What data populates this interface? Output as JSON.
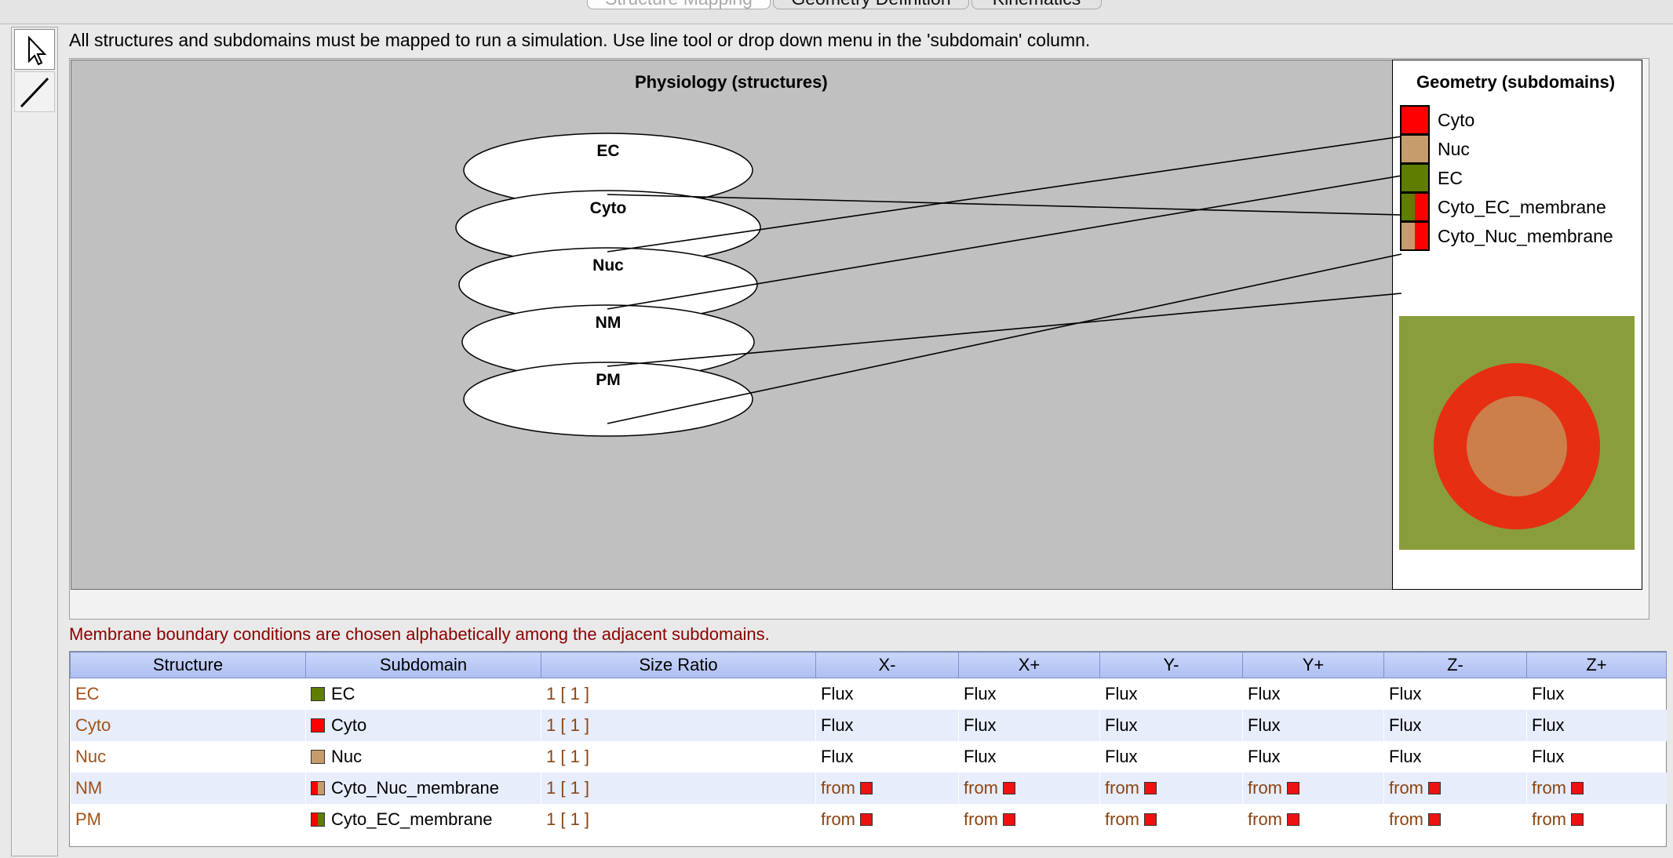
{
  "tabs": [
    {
      "label": "Structure Mapping",
      "selected": true
    },
    {
      "label": "Geometry Definition",
      "selected": false
    },
    {
      "label": "Kinematics",
      "selected": false
    }
  ],
  "tools": [
    {
      "icon": "select-arrow-icon"
    },
    {
      "icon": "line-tool-icon"
    }
  ],
  "hint": "All structures and subdomains must be mapped to run a simulation. Use line tool or drop down menu in the 'subdomain' column.",
  "physiology": {
    "title": "Physiology (structures)",
    "structures": [
      "EC",
      "Cyto",
      "Nuc",
      "NM",
      "PM"
    ]
  },
  "geometry": {
    "title": "Geometry (subdomains)",
    "subdomains": [
      {
        "label": "Cyto",
        "colors": [
          "#ff0000"
        ]
      },
      {
        "label": "Nuc",
        "colors": [
          "#c69c6d"
        ]
      },
      {
        "label": "EC",
        "colors": [
          "#5f7d00"
        ]
      },
      {
        "label": "Cyto_EC_membrane",
        "colors": [
          "#5f7d00",
          "#ff0000"
        ]
      },
      {
        "label": "Cyto_Nuc_membrane",
        "colors": [
          "#c69c6d",
          "#ff0000"
        ]
      }
    ]
  },
  "mappings": [
    {
      "structure": "EC",
      "subdomain": "EC"
    },
    {
      "structure": "Cyto",
      "subdomain": "Cyto"
    },
    {
      "structure": "Nuc",
      "subdomain": "Nuc"
    },
    {
      "structure": "NM",
      "subdomain": "Cyto_Nuc_membrane"
    },
    {
      "structure": "PM",
      "subdomain": "Cyto_EC_membrane"
    }
  ],
  "membrane_note": "Membrane boundary conditions are chosen alphabetically among the adjacent subdomains.",
  "table": {
    "headers": [
      "Structure",
      "Subdomain",
      "Size Ratio",
      "X-",
      "X+",
      "Y-",
      "Y+",
      "Z-",
      "Z+"
    ],
    "rows": [
      {
        "structure": "EC",
        "subdomain": "EC",
        "colors": [
          "#5f7d00"
        ],
        "ratio": "1 [ 1 ]",
        "bc": [
          "Flux",
          "Flux",
          "Flux",
          "Flux",
          "Flux",
          "Flux"
        ],
        "from": false
      },
      {
        "structure": "Cyto",
        "subdomain": "Cyto",
        "colors": [
          "#ff0000"
        ],
        "ratio": "1 [ 1 ]",
        "bc": [
          "Flux",
          "Flux",
          "Flux",
          "Flux",
          "Flux",
          "Flux"
        ],
        "from": false
      },
      {
        "structure": "Nuc",
        "subdomain": "Nuc",
        "colors": [
          "#c69c6d"
        ],
        "ratio": "1 [ 1 ]",
        "bc": [
          "Flux",
          "Flux",
          "Flux",
          "Flux",
          "Flux",
          "Flux"
        ],
        "from": false
      },
      {
        "structure": "NM",
        "subdomain": "Cyto_Nuc_membrane",
        "colors": [
          "#ff0000",
          "#c69c6d"
        ],
        "ratio": "1 [ 1 ]",
        "bc": [
          "from",
          "from",
          "from",
          "from",
          "from",
          "from"
        ],
        "from": true
      },
      {
        "structure": "PM",
        "subdomain": "Cyto_EC_membrane",
        "colors": [
          "#ff0000",
          "#5f7d00"
        ],
        "ratio": "1 [ 1 ]",
        "bc": [
          "from",
          "from",
          "from",
          "from",
          "from",
          "from"
        ],
        "from": true
      }
    ]
  }
}
